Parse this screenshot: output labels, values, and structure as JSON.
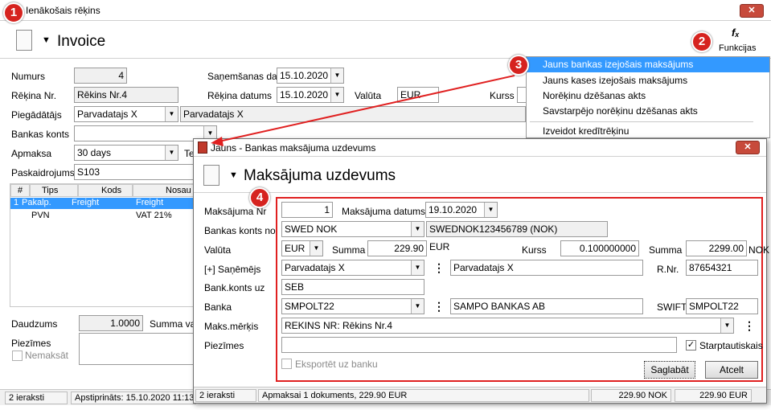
{
  "main_window": {
    "title": "Ienākošais rēķins",
    "header": "Invoice",
    "functions_label": "Funkcijas",
    "fields": {
      "numurs_label": "Numurs",
      "numurs_value": "4",
      "rekina_nr_label": "Rēķina Nr.",
      "rekina_nr_value": "Rēkins Nr.4",
      "piegadatajs_label": "Piegādātājs",
      "piegadatajs_value": "Parvadatajs X",
      "piegadatajs_name": "Parvadatajs X",
      "bankas_konts_label": "Bankas konts",
      "apmaksa_label": "Apmaksa",
      "apmaksa_value": "30 days",
      "te_label": "Te",
      "paskaidrojums_label": "Paskaidrojums",
      "paskaidrojums_value": "S103",
      "sanemsanas_label": "Saņemšanas dat.",
      "sanemsanas_value": "15.10.2020",
      "rekina_datums_label": "Rēķina datums",
      "rekina_datums_value": "15.10.2020",
      "valuta_label": "Valūta",
      "valuta_value": "EUR",
      "kurss_label": "Kurss"
    },
    "grid": {
      "headers": [
        "#",
        "Tips",
        "Kods",
        "Nosau"
      ],
      "rows": [
        [
          "1",
          "Pakalp.",
          "Freight",
          "Freight"
        ],
        [
          "",
          "PVN",
          "",
          "VAT 21%"
        ]
      ]
    },
    "daudzums_label": "Daudzums",
    "daudzums_value": "1.0000",
    "summa_val_label": "Summa val",
    "piezimes_label": "Piezīmes",
    "nemaksat_label": "Nemaksāt",
    "status": {
      "count": "2 ieraksti",
      "approved": "Apstiprināts: 15.10.2020 11:13"
    }
  },
  "functions_menu": {
    "items": [
      "Jauns bankas izejošais maksājums",
      "Jauns kases izejošais maksājums",
      "Norēķinu dzēšanas akts",
      "Savstarpējo norēķinu dzēšanas akts",
      "Izveidot kredītrēķinu"
    ]
  },
  "dialog": {
    "title": "Jauns - Bankas maksājuma uzdevums",
    "header": "Maksājuma uzdevums",
    "left_labels": [
      "Maksājuma Nr",
      "Bankas konts no",
      "Valūta",
      "[+] Saņēmējs",
      "Bank.konts uz",
      "Banka",
      "Maks.mērķis",
      "Piezīmes"
    ],
    "nr_value": "1",
    "datums_label": "Maksājuma datums",
    "datums_value": "19.10.2020",
    "bank_from_value": "SWED NOK",
    "bank_from_iban": "SWEDNOK123456789 (NOK)",
    "currency_value": "EUR",
    "summa_label": "Summa",
    "summa_value": "229.90",
    "summa_curr": "EUR",
    "kurss_label": "Kurss",
    "kurss_value": "0.100000000",
    "summa2_label": "Summa",
    "summa2_value": "2299.00",
    "summa2_curr": "NOK",
    "receiver_value": "Parvadatajs X",
    "receiver_name": "Parvadatajs X",
    "rnr_label": "R.Nr.",
    "rnr_value": "87654321",
    "bank_to_value": "SEB",
    "bank_value": "SMPOLT22",
    "bank_name": "SAMPO BANKAS AB",
    "swift_label": "SWIFT",
    "swift_value": "SMPOLT22",
    "purpose_value": "REKINS NR: Rēkins Nr.4",
    "international_label": "Starptautiskais",
    "export_label": "Eksportēt uz banku",
    "save_label": "Saglabāt",
    "cancel_label": "Atcelt",
    "status": {
      "count": "2 ieraksti",
      "summary": "Apmaksai 1 dokuments, 229.90 EUR",
      "nok": "229.90 NOK",
      "eur": "229.90 EUR"
    }
  },
  "badges": [
    "1",
    "2",
    "3",
    "4"
  ],
  "colors": {
    "highlight": "#3399ff",
    "badge": "#d6231f",
    "arrow": "#e02020",
    "title_icon": "#c0392b"
  }
}
